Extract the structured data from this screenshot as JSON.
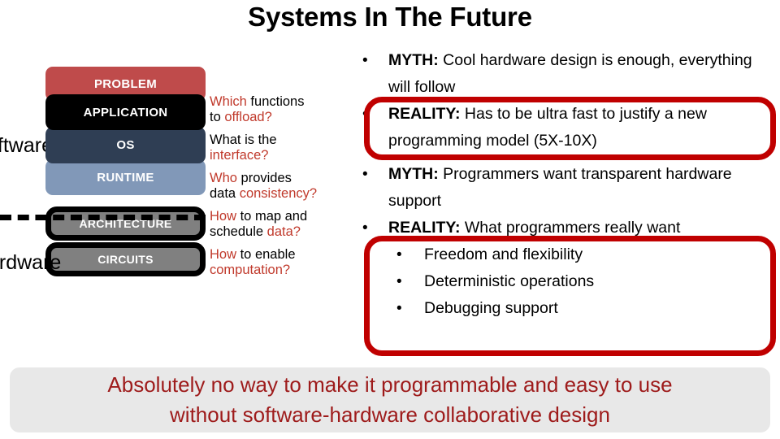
{
  "slide": {
    "title": "Systems In The Future"
  },
  "stack": {
    "side_labels": {
      "software": "oftware",
      "hardware": "ardware"
    },
    "layers": [
      {
        "name": "problem",
        "label": "PROBLEM",
        "color": "#bf4b4b"
      },
      {
        "name": "application",
        "label": "APPLICATION",
        "color": "#000000"
      },
      {
        "name": "os",
        "label": "OS",
        "color": "#2f3e54"
      },
      {
        "name": "runtime",
        "label": "RUNTIME",
        "color": "#8198b8"
      },
      {
        "name": "architecture",
        "label": "ARCHITECTURE",
        "color": "#808080"
      },
      {
        "name": "circuits",
        "label": "CIRCUITS",
        "color": "#808080"
      }
    ]
  },
  "questions": [
    {
      "a": "Which",
      "b": " functions",
      "c": "to ",
      "d": "offload?"
    },
    {
      "a": "",
      "b": "What is the",
      "c": "",
      "d": "interface?"
    },
    {
      "a": "Who",
      "b": " provides",
      "c": "data ",
      "d": "consistency?"
    },
    {
      "a": "How",
      "b": " to map and",
      "c": " schedule ",
      "d": "data?"
    },
    {
      "a": "How",
      "b": " to enable",
      "c": "",
      "d": "computation?"
    }
  ],
  "bullets": {
    "group1": {
      "myth_label": "MYTH:",
      "myth_text": " Cool hardware design is enough, everything will follow",
      "reality_label": "REALITY:",
      "reality_text": " Has to be ultra fast to justify a new programming model (5X-10X)"
    },
    "group2": {
      "myth_label": "MYTH:",
      "myth_text": " Programmers want transparent hardware support",
      "reality_label": "REALITY:",
      "reality_text": " What programmers really want",
      "sub_items": [
        "Freedom and flexibility",
        "Deterministic operations",
        "Debugging support"
      ]
    }
  },
  "banner": {
    "line1": "Absolutely no way to make it programmable and easy to use",
    "line2": "without software-hardware collaborative design",
    "text_color": "#9e1b1b",
    "background_color": "#e8e8e8"
  },
  "highlight": {
    "color": "#c00000"
  }
}
